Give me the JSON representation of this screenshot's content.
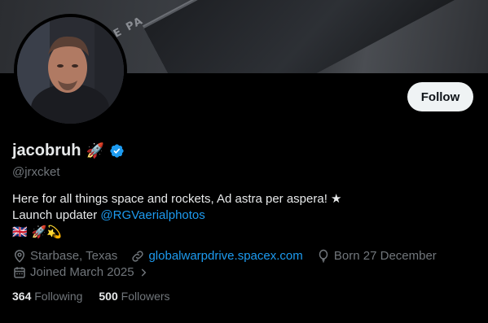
{
  "banner": {
    "text": "ONLY THE PA"
  },
  "profile": {
    "display_name": "jacobruh",
    "name_emoji": "🚀",
    "handle": "@jrxcket",
    "verified": true
  },
  "actions": {
    "follow_label": "Follow"
  },
  "bio": {
    "line1": "Here for all things space and rockets, Ad astra per aspera! ★",
    "line2_prefix": "Launch updater ",
    "line2_mention": "@RGVaerialphotos",
    "line3_emoji": "🇬🇧 🚀💫"
  },
  "meta": {
    "location": "Starbase, Texas",
    "website": "globalwarpdrive.spacex.com",
    "birthday": "Born 27 December",
    "joined": "Joined March 2025"
  },
  "stats": {
    "following_count": "364",
    "following_label": "Following",
    "followers_count": "500",
    "followers_label": "Followers"
  },
  "colors": {
    "accent": "#1d9bf0",
    "muted": "#71767b",
    "text": "#e7e9ea"
  }
}
